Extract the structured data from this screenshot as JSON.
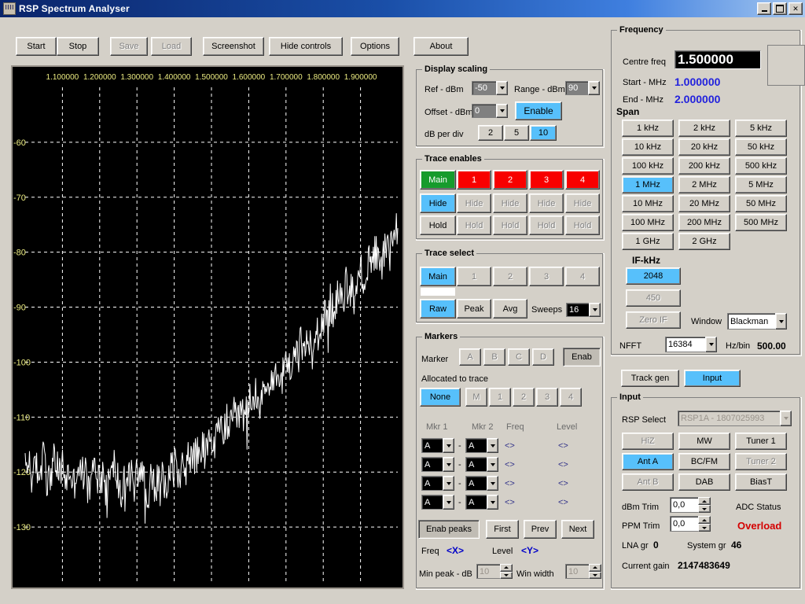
{
  "window": {
    "title": "RSP Spectrum Analyser",
    "icon": "app-icon",
    "minimize": "minimize-icon",
    "maximize": "maximize-icon",
    "close": "✕"
  },
  "toolbar": {
    "buttons": [
      {
        "label": "Start",
        "enabled": true
      },
      {
        "label": "Stop",
        "enabled": true
      },
      {
        "label": "Save",
        "enabled": false
      },
      {
        "label": "Load",
        "enabled": false
      },
      {
        "label": "Screenshot",
        "enabled": true
      },
      {
        "label": "Hide controls",
        "enabled": true
      },
      {
        "label": "Options",
        "enabled": true
      },
      {
        "label": "About",
        "enabled": true
      }
    ]
  },
  "display_scaling": {
    "title": "Display scaling",
    "ref_label": "Ref - dBm",
    "ref_value": "-50",
    "range_label": "Range - dBm",
    "range_value": "90",
    "offset_label": "Offset - dBm",
    "offset_value": "0",
    "enable_label": "Enable",
    "db_per_div_label": "dB per div",
    "db_per_div_options": [
      "2",
      "5",
      "10"
    ],
    "db_per_div_selected": "10"
  },
  "trace_enables": {
    "title": "Trace enables",
    "traces": [
      "Main",
      "1",
      "2",
      "3",
      "4"
    ],
    "hide_label": "Hide",
    "hold_label": "Hold",
    "hide_selected_index": 0
  },
  "trace_select": {
    "title": "Trace select",
    "traces": [
      "Main",
      "1",
      "2",
      "3",
      "4"
    ],
    "selected": "Main",
    "modes": [
      "Raw",
      "Peak",
      "Avg"
    ],
    "mode_selected": "Raw",
    "sweeps_label": "Sweeps",
    "sweeps_value": "16"
  },
  "markers": {
    "title": "Markers",
    "marker_label": "Marker",
    "marker_ids": [
      "A",
      "B",
      "C",
      "D"
    ],
    "enab_label": "Enab",
    "allocated_label": "Allocated to trace",
    "allocation_options": [
      "None",
      "M",
      "1",
      "2",
      "3",
      "4"
    ],
    "allocation_selected": "None",
    "col_mkr1": "Mkr 1",
    "col_mkr2": "Mkr 2",
    "col_freq": "Freq",
    "col_level": "Level",
    "rows": [
      {
        "mkr1": "A",
        "mkr2": "A",
        "freq": "<>",
        "level": "<>"
      },
      {
        "mkr1": "A",
        "mkr2": "A",
        "freq": "<>",
        "level": "<>"
      },
      {
        "mkr1": "A",
        "mkr2": "A",
        "freq": "<>",
        "level": "<>"
      },
      {
        "mkr1": "A",
        "mkr2": "A",
        "freq": "<>",
        "level": "<>"
      }
    ],
    "separator": "-",
    "enab_peaks_label": "Enab peaks",
    "first_label": "First",
    "prev_label": "Prev",
    "next_label": "Next",
    "freq_label": "Freq",
    "freq_value": "<X>",
    "level_label": "Level",
    "level_value": "<Y>",
    "min_peak_label": "Min peak - dB",
    "min_peak_value": "10",
    "win_width_label": "Win width",
    "win_width_value": "10"
  },
  "frequency": {
    "title": "Frequency",
    "centre_label": "Centre freq",
    "centre_value": "1.500000",
    "start_label": "Start - MHz",
    "start_value": "1.000000",
    "end_label": "End - MHz",
    "end_value": "2.000000",
    "value_color": "#2222dd"
  },
  "span": {
    "title": "Span",
    "options": [
      "1 kHz",
      "2 kHz",
      "5 kHz",
      "10 kHz",
      "20 kHz",
      "50 kHz",
      "100 kHz",
      "200 kHz",
      "500 kHz",
      "1 MHz",
      "2 MHz",
      "5 MHz",
      "10 MHz",
      "20 MHz",
      "50 MHz",
      "100 MHz",
      "200 MHz",
      "500 MHz",
      "1 GHz",
      "2 GHz"
    ],
    "selected": "1 MHz"
  },
  "if_section": {
    "title": "IF-kHz",
    "options": [
      "2048",
      "450"
    ],
    "selected": "2048",
    "zero_if_label": "Zero IF",
    "window_label": "Window",
    "window_value": "Blackman",
    "nfft_label": "NFFT",
    "nfft_value": "16384",
    "hz_bin_label": "Hz/bin",
    "hz_bin_value": "500.00"
  },
  "source_tabs": {
    "track_gen_label": "Track gen",
    "input_label": "Input",
    "selected": "Input"
  },
  "input": {
    "title": "Input",
    "rsp_select_label": "RSP Select",
    "rsp_select_value": "RSP1A - 1807025993",
    "buttons": [
      {
        "label": "HiZ",
        "state": "disabled"
      },
      {
        "label": "MW",
        "state": "normal"
      },
      {
        "label": "Tuner 1",
        "state": "normal"
      },
      {
        "label": "Ant A",
        "state": "selected"
      },
      {
        "label": "BC/FM",
        "state": "normal"
      },
      {
        "label": "Tuner 2",
        "state": "disabled"
      },
      {
        "label": "Ant B",
        "state": "disabled"
      },
      {
        "label": "DAB",
        "state": "normal"
      },
      {
        "label": "BiasT",
        "state": "normal"
      }
    ],
    "dbm_trim_label": "dBm Trim",
    "dbm_trim_value": "0,0",
    "ppm_trim_label": "PPM Trim",
    "ppm_trim_value": "0,0",
    "adc_status_label": "ADC Status",
    "adc_status_value": "Overload",
    "adc_status_color": "#d40000",
    "lna_gr_label": "LNA gr",
    "lna_gr_value": "0",
    "system_gr_label": "System gr",
    "system_gr_value": "46",
    "current_gain_label": "Current gain",
    "current_gain_value": "2147483649"
  },
  "chart_data": {
    "type": "line",
    "title": "",
    "xlabel": "",
    "ylabel": "",
    "xlim": [
      1.0,
      2.0
    ],
    "ylim": [
      -140,
      -50
    ],
    "grid": true,
    "trace_color": "#ffffff",
    "grid_color": "#ffffff",
    "background": "#000000",
    "axis_label_color": "#eaea80",
    "xticks": [
      "1.100000",
      "1.200000",
      "1.300000",
      "1.400000",
      "1.500000",
      "1.600000",
      "1.700000",
      "1.800000",
      "1.900000"
    ],
    "xtick_values": [
      1.1,
      1.2,
      1.3,
      1.4,
      1.5,
      1.6,
      1.7,
      1.8,
      1.9
    ],
    "yticks": [
      "-60",
      "-70",
      "-80",
      "-90",
      "-100",
      "-110",
      "-120",
      "-130"
    ],
    "ytick_values": [
      -60,
      -70,
      -80,
      -90,
      -100,
      -110,
      -120,
      -130
    ],
    "series": [
      {
        "name": "Main",
        "x": [
          1.0,
          1.01,
          1.02,
          1.03,
          1.04,
          1.05,
          1.06,
          1.07,
          1.08,
          1.09,
          1.1,
          1.11,
          1.12,
          1.13,
          1.14,
          1.15,
          1.16,
          1.17,
          1.18,
          1.19,
          1.2,
          1.21,
          1.22,
          1.23,
          1.24,
          1.25,
          1.26,
          1.27,
          1.28,
          1.29,
          1.3,
          1.31,
          1.32,
          1.33,
          1.34,
          1.35,
          1.36,
          1.37,
          1.38,
          1.39,
          1.4,
          1.41,
          1.42,
          1.43,
          1.44,
          1.45,
          1.46,
          1.47,
          1.48,
          1.49,
          1.5,
          1.51,
          1.52,
          1.53,
          1.54,
          1.55,
          1.56,
          1.57,
          1.58,
          1.59,
          1.6,
          1.61,
          1.62,
          1.63,
          1.64,
          1.65,
          1.66,
          1.67,
          1.68,
          1.69,
          1.7,
          1.71,
          1.72,
          1.73,
          1.74,
          1.75,
          1.76,
          1.77,
          1.78,
          1.79,
          1.8,
          1.81,
          1.82,
          1.83,
          1.84,
          1.85,
          1.86,
          1.87,
          1.88,
          1.89,
          1.9,
          1.91,
          1.92,
          1.93,
          1.94,
          1.95,
          1.96,
          1.97,
          1.98,
          1.99
        ],
        "y": [
          -120,
          -118,
          -122,
          -119,
          -121,
          -117,
          -123,
          -120,
          -118,
          -121,
          -119,
          -122,
          -120,
          -123,
          -119,
          -121,
          -120,
          -124,
          -121,
          -119,
          -122,
          -120,
          -123,
          -121,
          -119,
          -122,
          -125,
          -121,
          -120,
          -123,
          -121,
          -119,
          -122,
          -124,
          -120,
          -121,
          -123,
          -119,
          -122,
          -120,
          -118,
          -121,
          -119,
          -120,
          -117,
          -119,
          -116,
          -118,
          -115,
          -117,
          -113,
          -116,
          -112,
          -114,
          -111,
          -113,
          -110,
          -112,
          -108,
          -111,
          -107,
          -109,
          -105,
          -108,
          -104,
          -106,
          -102,
          -105,
          -101,
          -103,
          -99,
          -102,
          -98,
          -100,
          -96,
          -99,
          -95,
          -97,
          -93,
          -96,
          -91,
          -94,
          -89,
          -92,
          -88,
          -90,
          -86,
          -89,
          -85,
          -87,
          -83,
          -86,
          -82,
          -84,
          -80,
          -83,
          -79,
          -81,
          -78,
          -76
        ],
        "comment": "Rising noise-floor trace from about -120 dBm at 1.0 MHz to about -70 dBm near 2.0 MHz"
      }
    ]
  }
}
